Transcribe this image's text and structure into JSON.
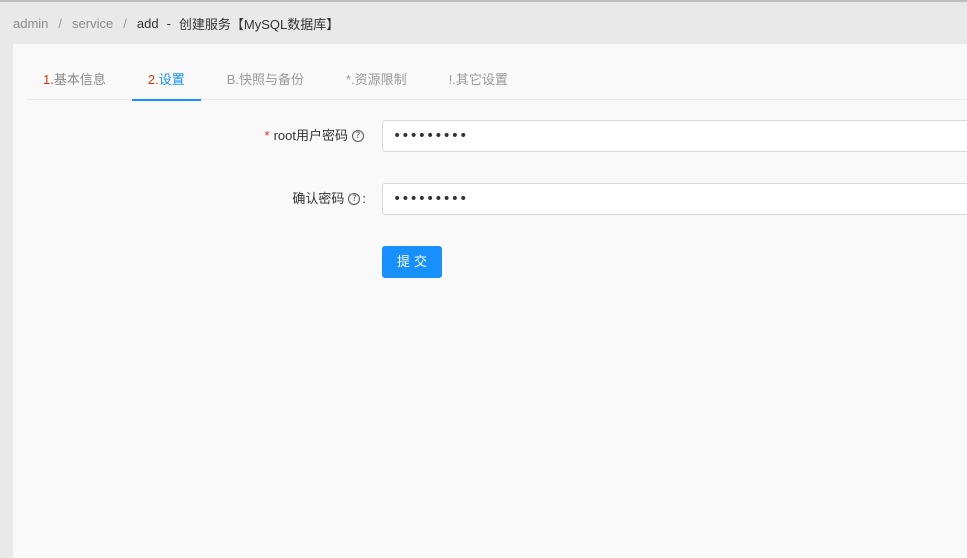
{
  "breadcrumb": {
    "items": [
      "admin",
      "service",
      "add"
    ],
    "separator": "/",
    "dash": "-",
    "page_title": "创建服务【MySQL数据库】"
  },
  "tabs": [
    {
      "num": "1.",
      "label": "基本信息",
      "state": "done"
    },
    {
      "num": "2.",
      "label": "设置",
      "state": "active"
    },
    {
      "num": "",
      "label": "B.快照与备份",
      "state": "inactive"
    },
    {
      "num": "",
      "label": "*.资源限制",
      "state": "inactive"
    },
    {
      "num": "",
      "label": "!.其它设置",
      "state": "inactive"
    }
  ],
  "form": {
    "root_password": {
      "required_mark": "*",
      "label": "root用户密码",
      "help_icon": "question-circle-icon",
      "value": "•••••••••"
    },
    "confirm_password": {
      "label": "确认密码",
      "help_icon": "question-circle-icon",
      "colon": ":",
      "value": "•••••••••"
    },
    "submit_label": "提交"
  },
  "colors": {
    "accent": "#1890ff",
    "step_number": "#d9370d",
    "required": "#f5222d"
  }
}
